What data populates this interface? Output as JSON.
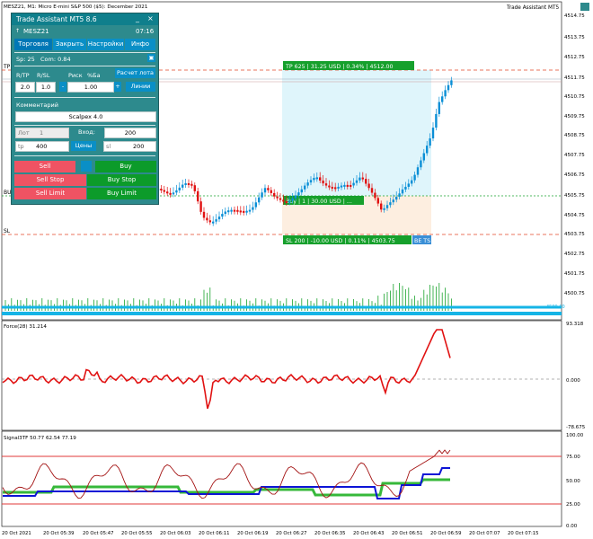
{
  "chart_header": {
    "title": "MESZ21, M1:  Micro E-mini S&P 500 ($5): December 2021",
    "indicator_name": "Trade Assistant MT5"
  },
  "price_axis": {
    "labels": [
      "4514.75",
      "4513.75",
      "4512.75",
      "4511.75",
      "4510.75",
      "4509.75",
      "4508.75",
      "4507.75",
      "4506.75",
      "4505.75",
      "4504.75",
      "4503.75",
      "4502.75",
      "4501.75",
      "4500.75",
      "4599.60"
    ]
  },
  "panel": {
    "title": "Trade Assistant MT5 8.6",
    "symbol": "MESZ21",
    "time": "07:16",
    "tabs": [
      "Торговля",
      "Закрыть",
      "Настройки",
      "Инфо"
    ],
    "spread": "Sp: 25",
    "commission": "Com: 0.84",
    "labels": {
      "rr": "R/TP",
      "rsl": "R/SL",
      "risk": "Риск",
      "pct": "%Ба",
      "calc": "Расчет лота",
      "rr_val": "2.0",
      "rsl_val": "1.0",
      "risk_val": "1.00",
      "lines": "Линии",
      "minus": "-",
      "plus": "+"
    },
    "comment_label": "Комментарий",
    "comment_value": "Scalpex 4.0",
    "lot_label": "Лот",
    "lot_value": "1",
    "entry_label": "Вход:",
    "entry_value": "200",
    "tp_label": "tp",
    "tp_value": "400",
    "prices_button": "Цены",
    "sl_label": "sl",
    "sl_value": "200",
    "sell": "Sell",
    "buy": "Buy",
    "sell_stop": "Sell Stop",
    "buy_stop": "Buy Stop",
    "sell_limit": "Sell Limit",
    "buy_limit": "Buy Limit"
  },
  "trade_labels": {
    "tp_line": "TP",
    "sl_line": "SL",
    "buy_line": "BUY",
    "tp_box": "TP 625 | 31.25 USD | 0.34% | 4512.00",
    "buy_box": "Buy | 1 | 30.00 USD | ...",
    "sl_box": "SL 200 | -10.00 USD | 0.11% | 4503.75",
    "be_ts": "BE TS"
  },
  "force_pane": {
    "title": "Force(28) 31.214",
    "labels": [
      "93.318",
      "0.000",
      "-78.675"
    ]
  },
  "signal_pane": {
    "title": "Signal3TF 50.77 62.54 77.19",
    "labels": [
      "100.00",
      "75.00",
      "50.00",
      "25.00",
      "0.00"
    ]
  },
  "time_axis": {
    "labels": [
      "20 Oct 2021",
      "20 Oct 05:39",
      "20 Oct 05:47",
      "20 Oct 05:55",
      "20 Oct 06:03",
      "20 Oct 06:11",
      "20 Oct 06:19",
      "20 Oct 06:27",
      "20 Oct 06:35",
      "20 Oct 06:43",
      "20 Oct 06:51",
      "20 Oct 06:59",
      "20 Oct 07:07",
      "20 Oct 07:15"
    ]
  },
  "colors": {
    "bull": "#0a8fd6",
    "bear": "#e11212",
    "force_line": "#e11212",
    "signal_dark_red": "#a31212",
    "signal_blue": "#0d14d6",
    "signal_green": "#36b83a",
    "panel_bg": "#2d8a8d"
  }
}
